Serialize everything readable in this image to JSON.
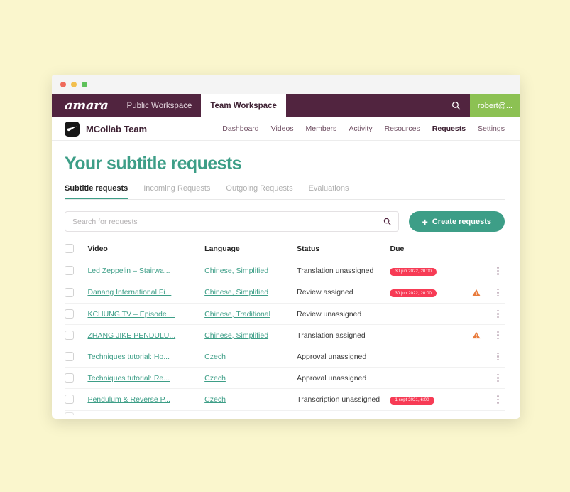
{
  "window": {
    "traffic_lights": [
      "close",
      "minimize",
      "zoom"
    ]
  },
  "topnav": {
    "brand": "amara",
    "workspaces": [
      {
        "label": "Public Workspace",
        "active": false
      },
      {
        "label": "Team Workspace",
        "active": true
      }
    ],
    "search_icon": "search-icon",
    "user": "robert@...",
    "bg_color": "#51243f",
    "user_chip_color": "#8cc153"
  },
  "team_header": {
    "name": "MCollab Team",
    "menu": [
      {
        "label": "Dashboard",
        "active": false
      },
      {
        "label": "Videos",
        "active": false
      },
      {
        "label": "Members",
        "active": false
      },
      {
        "label": "Activity",
        "active": false
      },
      {
        "label": "Resources",
        "active": false
      },
      {
        "label": "Requests",
        "active": true
      },
      {
        "label": "Settings",
        "active": false
      }
    ]
  },
  "main": {
    "title": "Your subtitle requests",
    "title_color": "#3d9e87",
    "tabs": [
      {
        "label": "Subtitle requests",
        "active": true
      },
      {
        "label": "Incoming Requests",
        "active": false
      },
      {
        "label": "Outgoing Requests",
        "active": false
      },
      {
        "label": "Evaluations",
        "active": false
      }
    ],
    "search": {
      "placeholder": "Search for requests",
      "value": ""
    },
    "create_button": {
      "label": "Create requests",
      "plus": "+",
      "color": "#3d9e87"
    }
  },
  "table": {
    "headers": [
      "Video",
      "Language",
      "Status",
      "Due"
    ],
    "rows": [
      {
        "video": "Led Zeppelin – Stairwa...",
        "language": "Chinese, Simplified",
        "status": "Translation unassigned",
        "due": "30 jun 2022, 20:00",
        "warning": false
      },
      {
        "video": "Danang International Fi...",
        "language": "Chinese, Simplified",
        "status": "Review assigned",
        "due": "30 jun 2022, 20:00",
        "warning": true
      },
      {
        "video": "KCHUNG TV – Episode ...",
        "language": "Chinese, Traditional",
        "status": "Review unassigned",
        "due": "",
        "warning": false
      },
      {
        "video": "ZHANG JIKE PENDULU...",
        "language": "Chinese, Simplified",
        "status": "Translation assigned",
        "due": "",
        "warning": true
      },
      {
        "video": "Techniques tutorial: Ho...",
        "language": "Czech",
        "status": "Approval unassigned",
        "due": "",
        "warning": false
      },
      {
        "video": "Techniques tutorial: Re...",
        "language": "Czech",
        "status": "Approval unassigned",
        "due": "",
        "warning": false
      },
      {
        "video": "Pendulum & Reverse P...",
        "language": "Czech",
        "status": "Transcription unassigned",
        "due": "1 sept 2021, 6:00",
        "warning": false
      }
    ],
    "badge_color": "#f73b55",
    "warning_color": "#e87b3c",
    "link_color": "#3d9e87"
  }
}
